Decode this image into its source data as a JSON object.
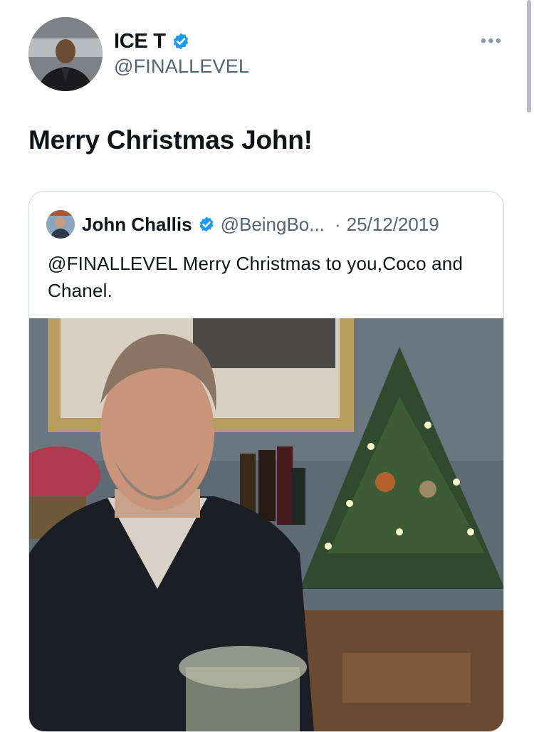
{
  "author": {
    "display_name": "ICE T",
    "handle": "@FINALLEVEL",
    "verified": true
  },
  "tweet": {
    "text": "Merry Christmas John!"
  },
  "quoted_tweet": {
    "display_name": "John Challis",
    "handle": "@BeingBo...",
    "separator": "·",
    "date": "25/12/2019",
    "verified": true,
    "text": "@FINALLEVEL  Merry Christmas to you,Coco and Chanel."
  },
  "icons": {
    "verified": "verified-badge-icon",
    "more": "more-options-icon"
  },
  "colors": {
    "verified_blue": "#1d9bf0",
    "secondary_text": "#536471",
    "border": "#cfd9de"
  }
}
